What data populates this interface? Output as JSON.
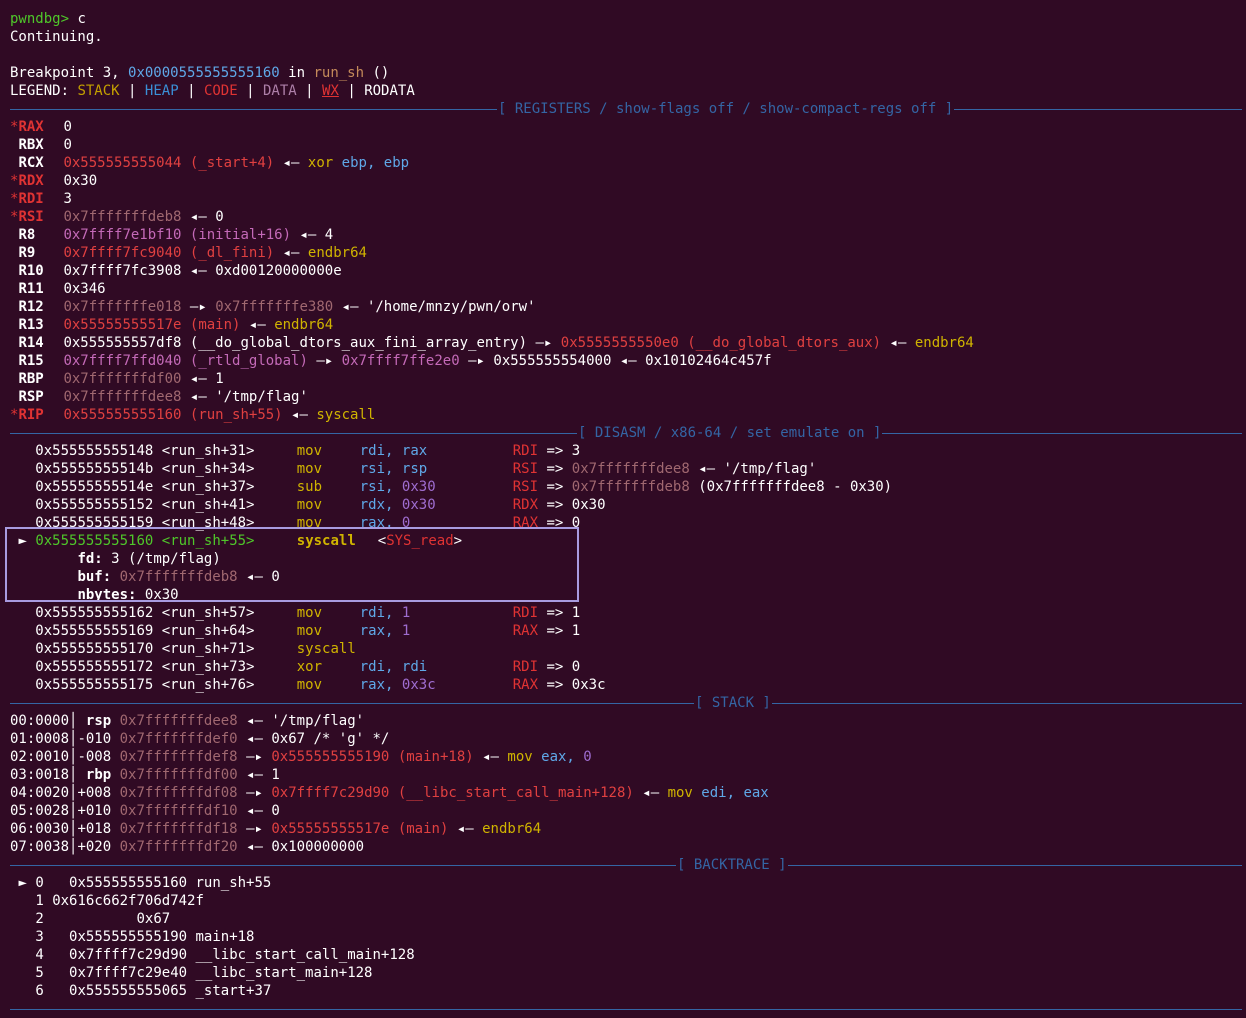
{
  "header": {
    "prompt": "pwndbg>",
    "command": "c",
    "continuing": "Continuing.",
    "bp_prefix": "Breakpoint 3,",
    "bp_addr": "0x0000555555555160",
    "bp_in": "in",
    "bp_func": "run_sh",
    "bp_parens": "()"
  },
  "legend": {
    "label": "LEGEND:",
    "stack": "STACK",
    "heap": "HEAP",
    "code": "CODE",
    "data": "DATA",
    "wx": "WX",
    "rodata": "RODATA",
    "sep": "|"
  },
  "sections": {
    "registers": "[ REGISTERS / show-flags off / show-compact-regs off ]",
    "disasm": "[ DISASM / x86-64 / set emulate on ]",
    "stack": "[ STACK ]",
    "backtrace": "[ BACKTRACE ]"
  },
  "registers": [
    {
      "star": "*",
      "name": "RAX",
      "value": "0"
    },
    {
      "star": " ",
      "name": "RBX",
      "value": "0"
    },
    {
      "star": " ",
      "name": "RCX",
      "value": "0x555555555044",
      "sym": "(_start+4)",
      "arrow": "◂—",
      "ins_op": "xor",
      "ins_args": "ebp, ebp"
    },
    {
      "star": "*",
      "name": "RDX",
      "value": "0x30"
    },
    {
      "star": "*",
      "name": "RDI",
      "value": "3"
    },
    {
      "star": "*",
      "name": "RSI",
      "value": "0x7fffffffdeb8",
      "arrow": "◂—",
      "target": "0"
    },
    {
      "star": " ",
      "name": "R8",
      "value": "0x7ffff7e1bf10",
      "sym": "(initial+16)",
      "arrow": "◂—",
      "target": "4"
    },
    {
      "star": " ",
      "name": "R9",
      "value": "0x7ffff7fc9040",
      "sym": "(_dl_fini)",
      "arrow": "◂—",
      "target": "endbr64"
    },
    {
      "star": " ",
      "name": "R10",
      "value": "0x7ffff7fc3908",
      "arrow": "◂—",
      "target": "0xd00120000000e"
    },
    {
      "star": " ",
      "name": "R11",
      "value": "0x346"
    },
    {
      "star": " ",
      "name": "R12",
      "value": "0x7fffffffe018",
      "arrow": "—▸",
      "value2": "0x7fffffffe380",
      "arrow2": "◂—",
      "target": "'/home/mnzy/pwn/orw'"
    },
    {
      "star": " ",
      "name": "R13",
      "value": "0x55555555517e",
      "sym": "(main)",
      "arrow": "◂—",
      "target": "endbr64"
    },
    {
      "star": " ",
      "name": "R14",
      "value": "0x555555557df8",
      "sym": "(__do_global_dtors_aux_fini_array_entry)",
      "arrow": "—▸",
      "value2": "0x5555555550e0",
      "sym2": "(__do_global_dtors_aux)",
      "arrow2": "◂—",
      "target": "endbr64"
    },
    {
      "star": " ",
      "name": "R15",
      "value": "0x7ffff7ffd040",
      "sym": "(_rtld_global)",
      "arrow": "—▸",
      "value2": "0x7ffff7ffe2e0",
      "arrow2": "—▸",
      "value3": "0x555555554000",
      "arrow3": "◂—",
      "target": "0x10102464c457f"
    },
    {
      "star": " ",
      "name": "RBP",
      "value": "0x7fffffffdf00",
      "arrow": "◂—",
      "target": "1"
    },
    {
      "star": " ",
      "name": "RSP",
      "value": "0x7fffffffdee8",
      "arrow": "◂—",
      "target": "'/tmp/flag'"
    },
    {
      "star": "*",
      "name": "RIP",
      "value": "0x555555555160",
      "sym": "(run_sh+55)",
      "arrow": "◂—",
      "target": "syscall"
    }
  ],
  "disasm": {
    "before": [
      {
        "addr": "0x555555555148",
        "loc": "<run_sh+31>",
        "op": "mov",
        "a1": "rdi,",
        "a2": "rax",
        "reg": "RDI",
        "eq": "=>",
        "res": "3"
      },
      {
        "addr": "0x55555555514b",
        "loc": "<run_sh+34>",
        "op": "mov",
        "a1": "rsi,",
        "a2": "rsp",
        "reg": "RSI",
        "eq": "=>",
        "res": "0x7fffffffdee8",
        "res_arrow": "◂—",
        "res_tail": "'/tmp/flag'"
      },
      {
        "addr": "0x55555555514e",
        "loc": "<run_sh+37>",
        "op": "sub",
        "a1": "rsi,",
        "a2": "0x30",
        "reg": "RSI",
        "eq": "=>",
        "res": "0x7fffffffdeb8",
        "res_tail": "(0x7fffffffdee8 - 0x30)"
      },
      {
        "addr": "0x555555555152",
        "loc": "<run_sh+41>",
        "op": "mov",
        "a1": "rdx,",
        "a2": "0x30",
        "reg": "RDX",
        "eq": "=>",
        "res": "0x30"
      },
      {
        "addr": "0x555555555159",
        "loc": "<run_sh+48>",
        "op": "mov",
        "a1": "rax,",
        "a2": "0",
        "reg": "RAX",
        "eq": "=>",
        "res": "0"
      }
    ],
    "current": {
      "marker": "►",
      "addr": "0x555555555160",
      "loc": "<run_sh+55>",
      "op": "syscall",
      "call_open": "<",
      "call": "SYS_read",
      "call_close": ">",
      "fd_label": "fd:",
      "fd_val": "3 (/tmp/flag)",
      "buf_label": "buf:",
      "buf_val": "0x7fffffffdeb8",
      "buf_arrow": "◂—",
      "buf_target": "0",
      "nbytes_label": "nbytes:",
      "nbytes_val": "0x30"
    },
    "after": [
      {
        "addr": "0x555555555162",
        "loc": "<run_sh+57>",
        "op": "mov",
        "a1": "rdi,",
        "a2": "1",
        "reg": "RDI",
        "eq": "=>",
        "res": "1"
      },
      {
        "addr": "0x555555555169",
        "loc": "<run_sh+64>",
        "op": "mov",
        "a1": "rax,",
        "a2": "1",
        "reg": "RAX",
        "eq": "=>",
        "res": "1"
      },
      {
        "addr": "0x555555555170",
        "loc": "<run_sh+71>",
        "op": "syscall"
      },
      {
        "addr": "0x555555555172",
        "loc": "<run_sh+73>",
        "op": "xor",
        "a1": "rdi,",
        "a2": "rdi",
        "reg": "RDI",
        "eq": "=>",
        "res": "0"
      },
      {
        "addr": "0x555555555175",
        "loc": "<run_sh+76>",
        "op": "mov",
        "a1": "rax,",
        "a2": "0x3c",
        "reg": "RAX",
        "eq": "=>",
        "res": "0x3c"
      }
    ]
  },
  "stack": [
    {
      "idx": "00:0000",
      "reg": "rsp",
      "addr": "0x7fffffffdee8",
      "arrow": "◂—",
      "rest": "'/tmp/flag'"
    },
    {
      "idx": "01:0008",
      "off": "-010",
      "addr": "0x7fffffffdef0",
      "arrow": "◂—",
      "rest": "0x67 /* 'g' */"
    },
    {
      "idx": "02:0010",
      "off": "-008",
      "addr": "0x7fffffffdef8",
      "arrow": "—▸",
      "v2": "0x555555555190",
      "sym": "(main+18)",
      "arrow2": "◂—",
      "op": "mov",
      "args": "eax,",
      "argnum": "0"
    },
    {
      "idx": "03:0018",
      "reg": "rbp",
      "addr": "0x7fffffffdf00",
      "arrow": "◂—",
      "rest": "1"
    },
    {
      "idx": "04:0020",
      "off": "+008",
      "addr": "0x7fffffffdf08",
      "arrow": "—▸",
      "v2": "0x7ffff7c29d90",
      "sym": "(__libc_start_call_main+128)",
      "arrow2": "◂—",
      "op": "mov",
      "args": "edi,",
      "argnum": "eax"
    },
    {
      "idx": "05:0028",
      "off": "+010",
      "addr": "0x7fffffffdf10",
      "arrow": "◂—",
      "rest": "0"
    },
    {
      "idx": "06:0030",
      "off": "+018",
      "addr": "0x7fffffffdf18",
      "arrow": "—▸",
      "v2": "0x55555555517e",
      "sym": "(main)",
      "arrow2": "◂—",
      "op": "endbr64"
    },
    {
      "idx": "07:0038",
      "off": "+020",
      "addr": "0x7fffffffdf20",
      "arrow": "◂—",
      "rest": "0x100000000"
    }
  ],
  "stack_bar": "│",
  "backtrace": [
    {
      "marker": "►",
      "num": "0",
      "text": "  0x555555555160 run_sh+55"
    },
    {
      "marker": " ",
      "num": "1",
      "text": "0x616c662f706d742f"
    },
    {
      "marker": " ",
      "num": "2",
      "text": "          0x67"
    },
    {
      "marker": " ",
      "num": "3",
      "text": "  0x555555555190 main+18"
    },
    {
      "marker": " ",
      "num": "4",
      "text": "  0x7ffff7c29d90 __libc_start_call_main+128"
    },
    {
      "marker": " ",
      "num": "5",
      "text": "  0x7ffff7c29e40 __libc_start_main+128"
    },
    {
      "marker": " ",
      "num": "6",
      "text": "  0x555555555065 _start+37"
    }
  ],
  "colors": {
    "background": "#300a24",
    "separator": "#3465a4",
    "highlight_box": "#a89be0"
  }
}
